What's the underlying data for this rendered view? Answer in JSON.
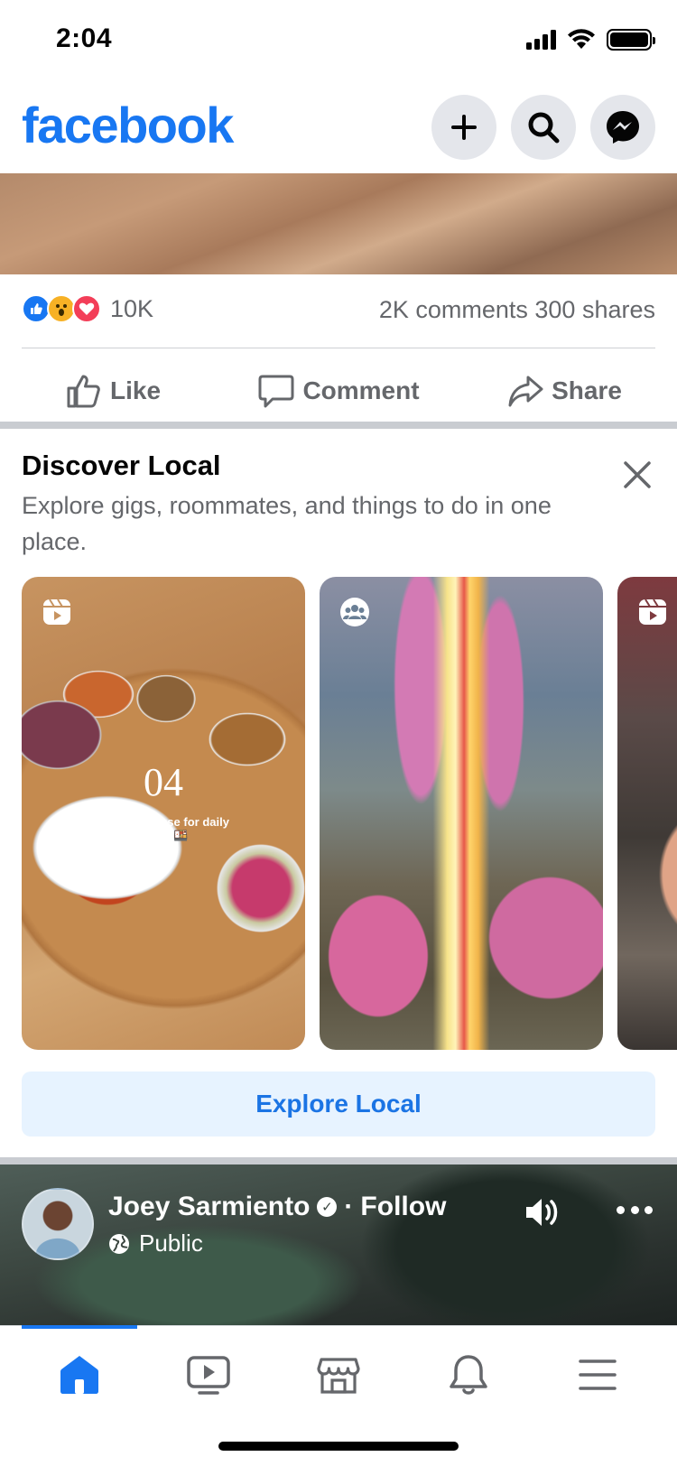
{
  "status_bar": {
    "time": "2:04"
  },
  "header": {
    "logo": "facebook",
    "buttons": [
      "create-post",
      "search",
      "messenger"
    ]
  },
  "post": {
    "reaction_count": "10K",
    "engagement": "2K comments 300 shares",
    "actions": {
      "like": "Like",
      "comment": "Comment",
      "share": "Share"
    }
  },
  "discover": {
    "title": "Discover Local",
    "subtitle": "Explore gigs, roommates, and things to do in one place.",
    "cards": [
      {
        "icon": "reels-icon",
        "big_text": "04",
        "small_text": "Made in House for daily bento 🍱"
      },
      {
        "icon": "groups-icon"
      },
      {
        "icon": "reels-icon"
      }
    ],
    "explore_label": "Explore Local"
  },
  "video_post": {
    "author": "Joey Sarmiento",
    "follow_label": "Follow",
    "separator": "·",
    "audience": "Public"
  },
  "bottom_nav": {
    "items": [
      "home",
      "video",
      "marketplace",
      "notifications",
      "menu"
    ],
    "active": "home"
  },
  "colors": {
    "brand": "#1877f2",
    "secondary_text": "#65676b",
    "explore_bg": "#e7f3ff",
    "explore_text": "#1b74e4"
  }
}
